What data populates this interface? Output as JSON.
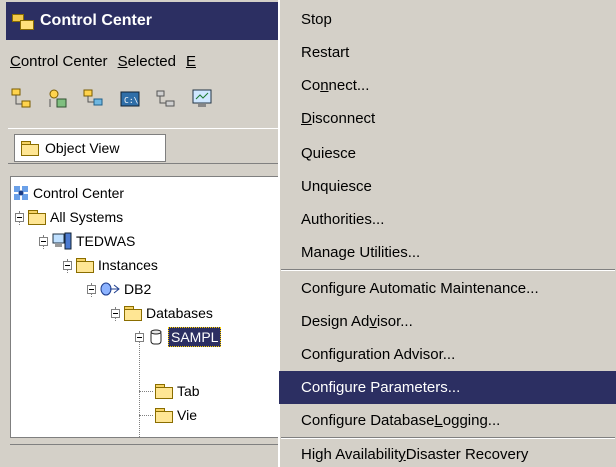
{
  "window": {
    "title": "Control Center",
    "menu": [
      "Control Center",
      "Selected",
      "E"
    ],
    "toolbar_icons": [
      "system-tree-icon",
      "add-system-icon",
      "tree-view-icon",
      "command-icon",
      "task-icon",
      "monitor-icon"
    ],
    "object_view_label": "Object View"
  },
  "tree": {
    "rows": [
      {
        "label": "Control Center",
        "icon": "control-center-icon"
      },
      {
        "label": "All Systems",
        "icon": "folder-icon"
      },
      {
        "label": "TEDWAS",
        "icon": "computer-icon"
      },
      {
        "label": "Instances",
        "icon": "folder-icon"
      },
      {
        "label": "DB2",
        "icon": "instance-icon"
      },
      {
        "label": "Databases",
        "icon": "folder-icon"
      },
      {
        "label": "SAMPL",
        "icon": "database-icon",
        "selected": true
      },
      {
        "label": "Tab",
        "icon": "folder-icon"
      },
      {
        "label": "Vie",
        "icon": "folder-icon"
      }
    ]
  },
  "context_menu": {
    "items": [
      {
        "pre": "",
        "ul": "",
        "post": "Stop"
      },
      {
        "pre": "",
        "ul": "",
        "post": "Restart"
      },
      {
        "pre": "Co",
        "ul": "n",
        "post": "nect..."
      },
      {
        "pre": "",
        "ul": "D",
        "post": "isconnect"
      },
      {
        "pre": "",
        "ul": "",
        "post": "Quiesce"
      },
      {
        "pre": "",
        "ul": "",
        "post": "Unquiesce"
      },
      {
        "pre": "",
        "ul": "",
        "post": "Authorities..."
      },
      {
        "pre": "",
        "ul": "",
        "post": "Manage Utilities..."
      },
      {
        "pre": "",
        "ul": "",
        "post": "Configure Automatic Maintenance..."
      },
      {
        "pre": "Design Ad",
        "ul": "v",
        "post": "isor..."
      },
      {
        "pre": "",
        "ul": "",
        "post": "Configuration Advisor..."
      },
      {
        "pre": "Confi",
        "ul": "g",
        "post": "ure Parameters..."
      },
      {
        "pre": "Configure Database ",
        "ul": "L",
        "post": "ogging..."
      },
      {
        "pre": "High Availabilit",
        "ul": "y",
        "post": " Disaster Recovery"
      }
    ],
    "highlighted_index": 11
  },
  "colors": {
    "title_bg": "#2c2f62",
    "highlight_bg": "#2c2f62",
    "window_bg": "#d4d0c8"
  }
}
